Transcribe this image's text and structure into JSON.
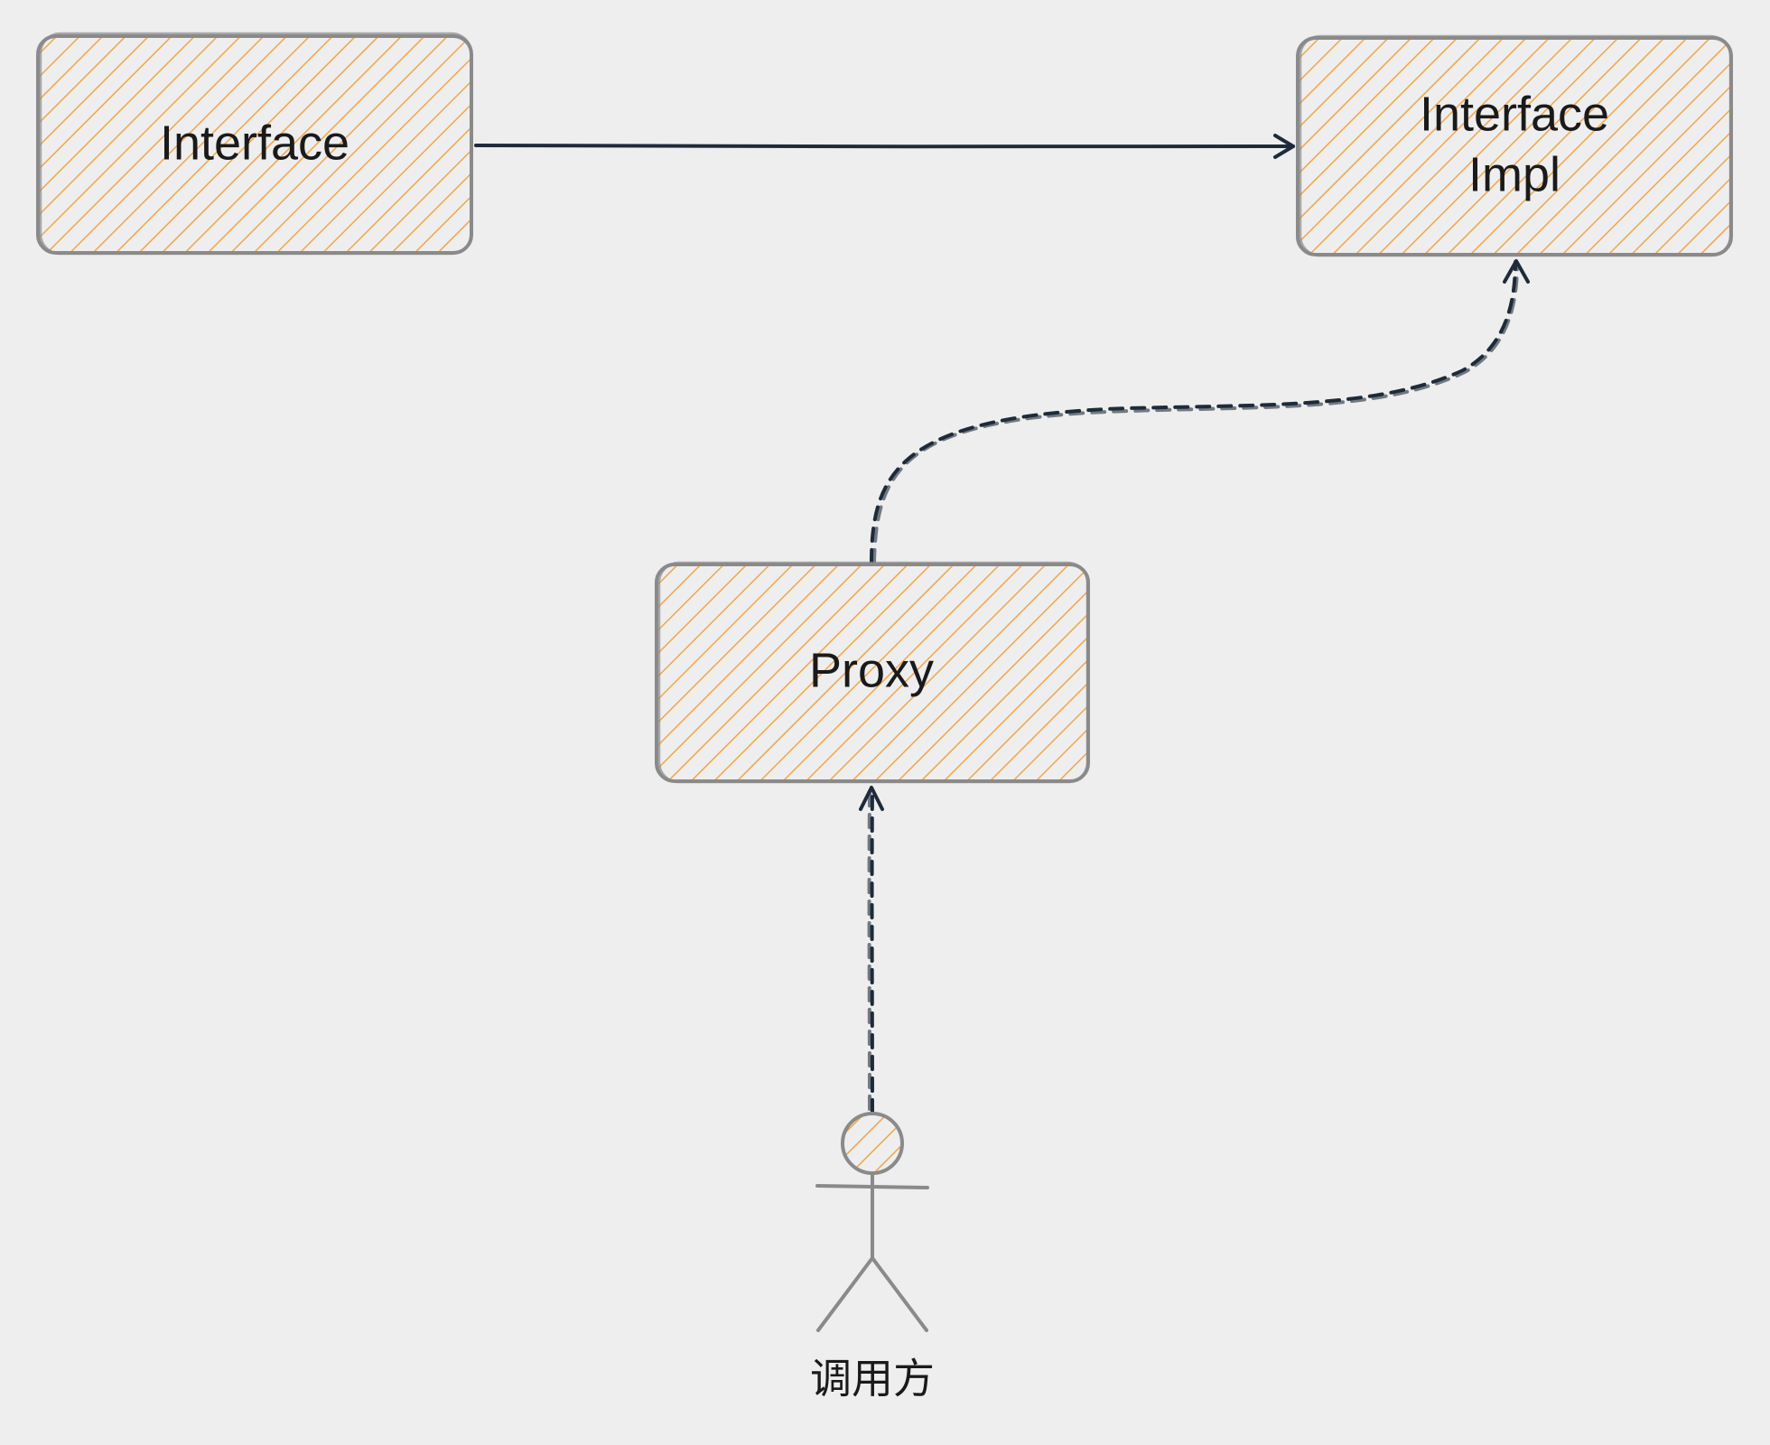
{
  "diagram": {
    "style": "hand-drawn",
    "colors": {
      "background": "#eeeeee",
      "fill_hatch": "#f2a54a",
      "outline": "#8a8a8a",
      "edge": "#1e2b3a",
      "text": "#1a1a1a"
    },
    "nodes": {
      "interface": {
        "label": "Interface"
      },
      "impl": {
        "label_line1": "Interface",
        "label_line2": "Impl"
      },
      "proxy": {
        "label": "Proxy"
      },
      "caller": {
        "label": "调用方",
        "icon": "stick-figure-icon"
      }
    },
    "edges": [
      {
        "from": "Interface",
        "to": "Interface Impl",
        "style": "solid"
      },
      {
        "from": "Proxy",
        "to": "Interface Impl",
        "style": "dashed"
      },
      {
        "from": "调用方",
        "to": "Proxy",
        "style": "dashed"
      }
    ]
  }
}
